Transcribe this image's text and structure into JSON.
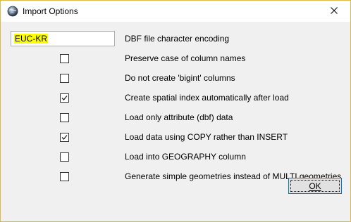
{
  "window": {
    "title": "Import Options",
    "close_symbol": "✕"
  },
  "encoding": {
    "value": "EUC-KR",
    "label": "DBF file character encoding"
  },
  "options": [
    {
      "label": "Preserve case of column names",
      "checked": false
    },
    {
      "label": "Do not create 'bigint' columns",
      "checked": false
    },
    {
      "label": "Create spatial index automatically after load",
      "checked": true
    },
    {
      "label": "Load only attribute (dbf) data",
      "checked": false
    },
    {
      "label": "Load data using COPY rather than INSERT",
      "checked": true
    },
    {
      "label": "Load into GEOGRAPHY column",
      "checked": false
    },
    {
      "label": "Generate simple geometries instead of MULTI geometries",
      "checked": false
    }
  ],
  "buttons": {
    "ok_label": "OK"
  },
  "colors": {
    "highlight": "#ffff00",
    "focus_border": "#0078d7",
    "window_border": "#e0b84a"
  }
}
